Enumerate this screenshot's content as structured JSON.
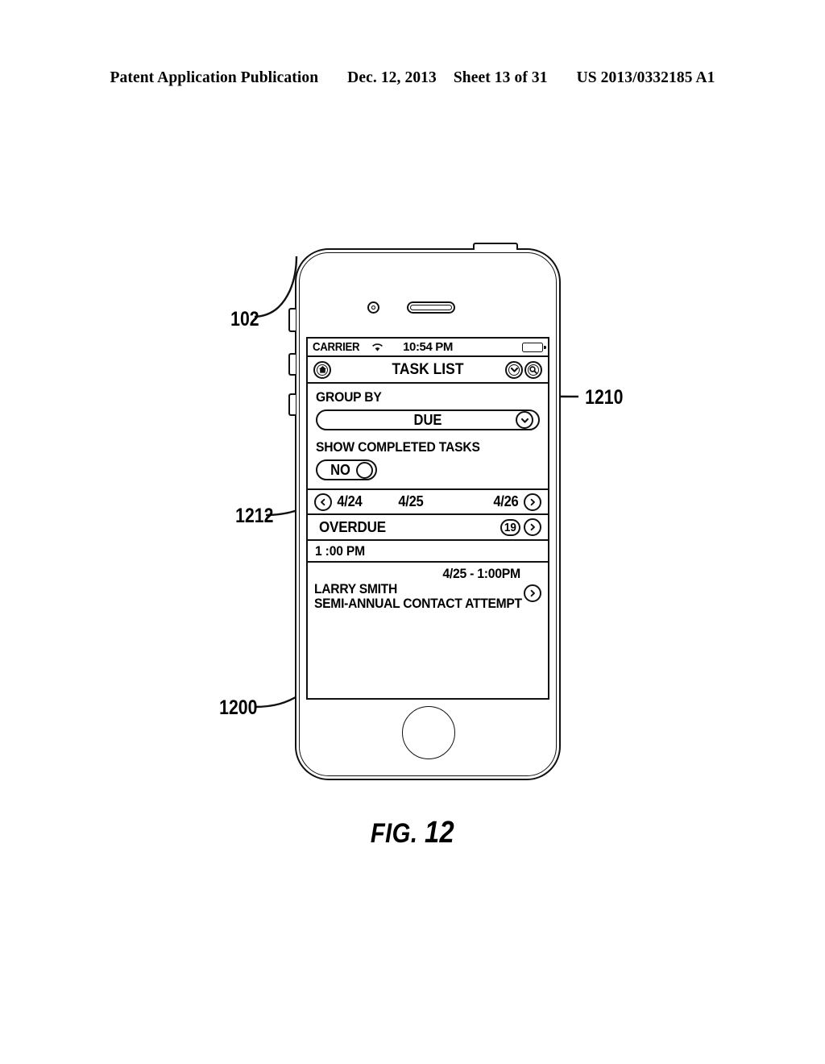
{
  "patent_header": {
    "publication": "Patent Application Publication",
    "date": "Dec. 12, 2013",
    "sheet": "Sheet 13 of 31",
    "number": "US 2013/0332185 A1"
  },
  "figure": {
    "caption_prefix": "FIG.",
    "caption_number": "12"
  },
  "reference_numerals": {
    "device": "102",
    "screen": "1200",
    "nav_filter": "1210",
    "toggle": "1212"
  },
  "phone_screen": {
    "status_bar": {
      "carrier": "CARRIER",
      "wifi_icon": "wifi-icon",
      "time": "10:54 PM",
      "battery_icon": "battery-icon"
    },
    "nav_bar": {
      "home_icon": "home-icon",
      "title": "TASK LIST",
      "filter_icon": "chevron-down-icon",
      "search_icon": "search-icon"
    },
    "settings": {
      "group_by_label": "GROUP BY",
      "group_by_value": "DUE",
      "group_by_caret_icon": "chevron-down-icon",
      "show_completed_label": "SHOW COMPLETED TASKS",
      "show_completed_value": "NO"
    },
    "date_strip": {
      "prev_icon": "chevron-left-icon",
      "dates": [
        "4/24",
        "4/25",
        "4/26"
      ],
      "next_icon": "chevron-right-icon"
    },
    "groups": [
      {
        "title": "OVERDUE",
        "count": "19",
        "disclosure_icon": "chevron-right-icon"
      }
    ],
    "time_header": "1 :00 PM",
    "tasks": [
      {
        "when": "4/25 - 1:00PM",
        "name": "LARRY SMITH",
        "description": "SEMI-ANNUAL CONTACT ATTEMPT",
        "disclosure_icon": "chevron-right-icon"
      }
    ]
  }
}
